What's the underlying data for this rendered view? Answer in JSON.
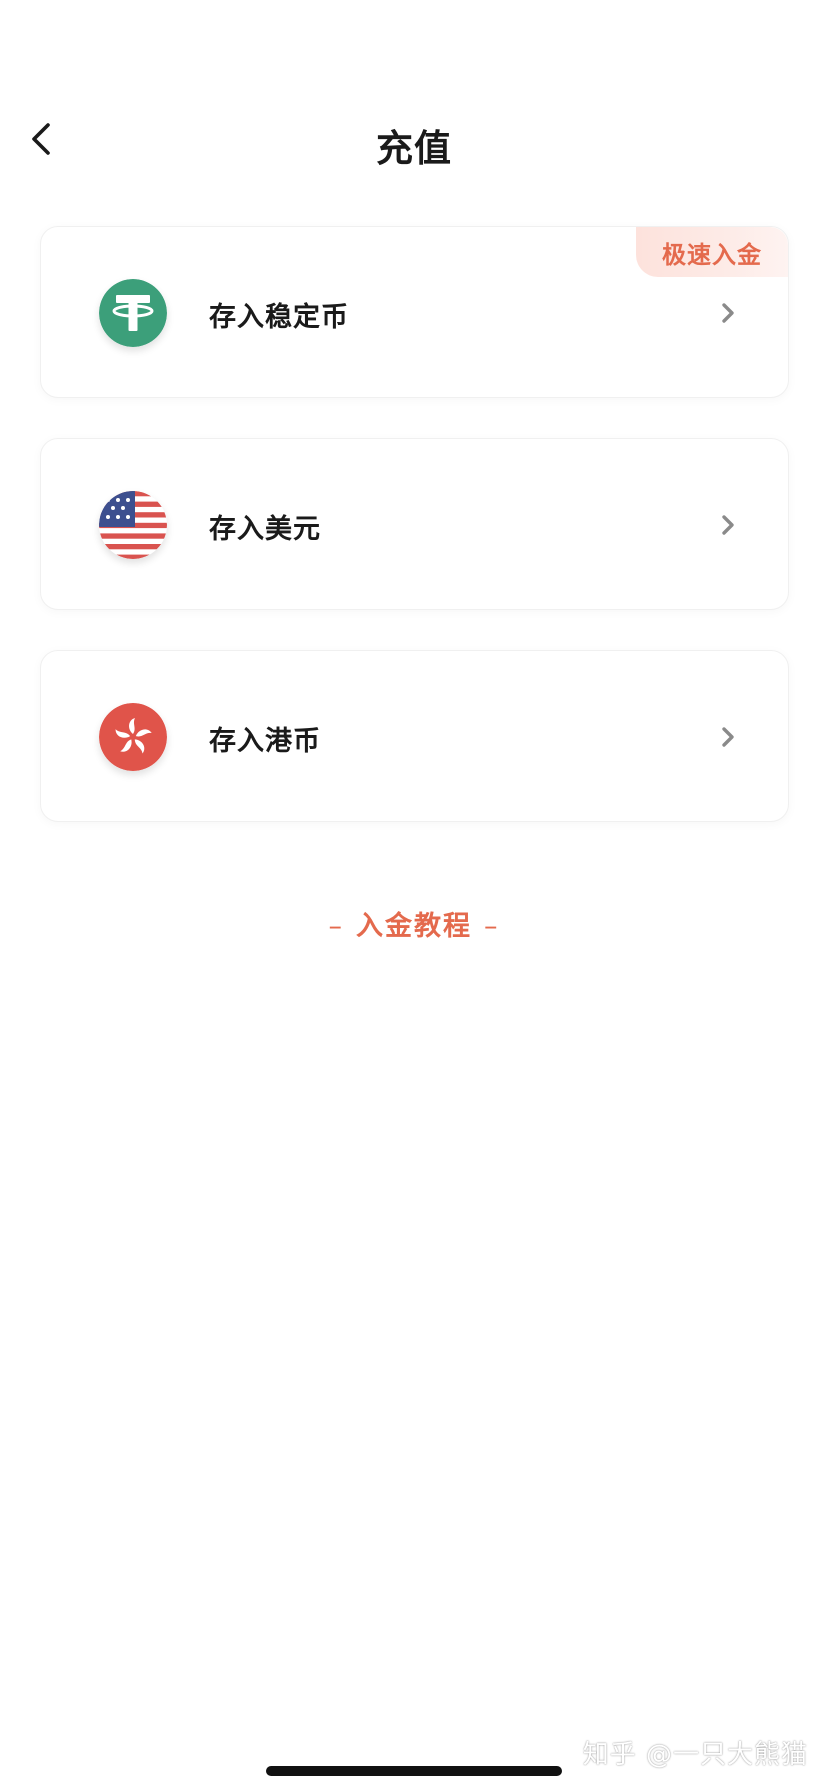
{
  "header": {
    "title": "充值",
    "back_icon": "chevron-left-icon"
  },
  "options": [
    {
      "label": "存入稳定币",
      "icon": "tether-usdt-icon",
      "icon_color": "#3c9f7a",
      "badge": "极速入金"
    },
    {
      "label": "存入美元",
      "icon": "us-flag-icon",
      "icon_color": "#d9534f"
    },
    {
      "label": "存入港币",
      "icon": "hk-bauhinia-icon",
      "icon_color": "#e0544a"
    }
  ],
  "tutorial": {
    "label": "入金教程",
    "dash_left": "–",
    "dash_right": "–"
  },
  "watermark": "知乎 @一只大熊猫",
  "colors": {
    "accent": "#e46a4d",
    "text": "#1a1a1a",
    "chevron": "#8a8a8a",
    "badge_bg": "#fde6e1"
  }
}
